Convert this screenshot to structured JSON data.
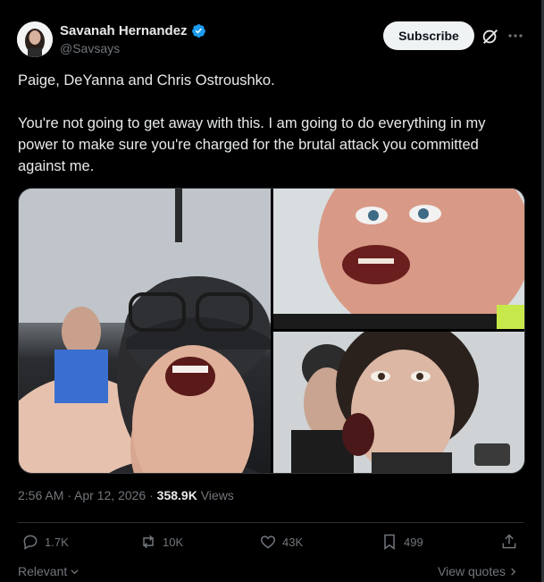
{
  "author": {
    "display_name": "Savanah Hernandez",
    "handle": "@Savsays",
    "verified_color": "#1d9bf0"
  },
  "header": {
    "subscribe_label": "Subscribe"
  },
  "tweet": {
    "text": "Paige, DeYanna and Chris Ostroushko.\n\nYou're not going to get away with this. I am going to do everything in my power to make sure you're charged for the brutal attack you committed against me."
  },
  "meta": {
    "time": "2:56 AM",
    "date": "Apr 12, 2026",
    "views_count": "358.9K",
    "views_label": "Views"
  },
  "actions": {
    "replies": "1.7K",
    "reposts": "10K",
    "likes": "43K",
    "bookmarks": "499"
  },
  "footer": {
    "sort_label": "Relevant",
    "quotes_label": "View quotes"
  }
}
